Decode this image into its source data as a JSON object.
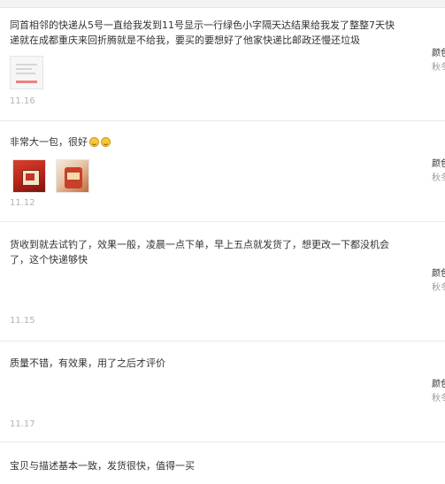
{
  "reviews": [
    {
      "content": "同首相邻的快递从5号一直给我发到11号显示一行绿色小字隔天达结果给我发了整整7天快递就在成都重庆来回折腾就是不给我，要买的要想好了他家快递比邮政还慢还垃圾",
      "date": "11.16",
      "user": {
        "name": "颜色",
        "level": "秋冬"
      },
      "images": [
        {
          "icon": "screenshot-thumbnail"
        }
      ]
    },
    {
      "content": "非常大一包，很好",
      "emoji": [
        "grin-emoji",
        "grin-emoji"
      ],
      "date": "11.12",
      "user": {
        "name": "颜色",
        "level": "秋冬"
      },
      "images": [
        {
          "icon": "red-package-photo"
        },
        {
          "icon": "snack-bag-photo"
        }
      ]
    },
    {
      "content": "货收到就去试钓了，效果一般，凌晨一点下单，早上五点就发货了，想更改一下都没机会了，这个快递够快",
      "date": "11.15",
      "user": {
        "name": "颜色",
        "level": "秋冬"
      },
      "images": []
    },
    {
      "content": "质量不错，有效果，用了之后才评价",
      "date": "11.17",
      "user": {
        "name": "颜色",
        "level": "秋冬"
      },
      "images": []
    },
    {
      "content": "宝贝与描述基本一致，发货很快，值得一买",
      "date": "",
      "user": {
        "name": "",
        "level": ""
      },
      "images": []
    }
  ]
}
